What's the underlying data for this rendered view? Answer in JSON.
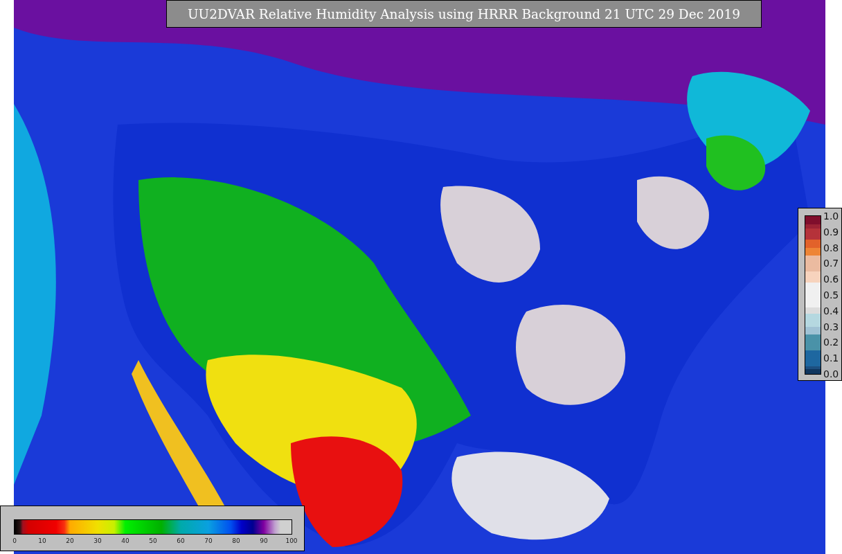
{
  "title": "UU2DVAR Relative Humidity Analysis using HRRR Background 21 UTC 29 Dec 2019",
  "observation_colorbar": {
    "ticks": [
      "1.0",
      "0.9",
      "0.8",
      "0.7",
      "0.6",
      "0.5",
      "0.4",
      "0.3",
      "0.2",
      "0.1",
      "0.0"
    ]
  },
  "analysis_colorbar": {
    "ticks": [
      "0",
      "10",
      "20",
      "30",
      "40",
      "50",
      "60",
      "70",
      "80",
      "90",
      "100"
    ]
  }
}
